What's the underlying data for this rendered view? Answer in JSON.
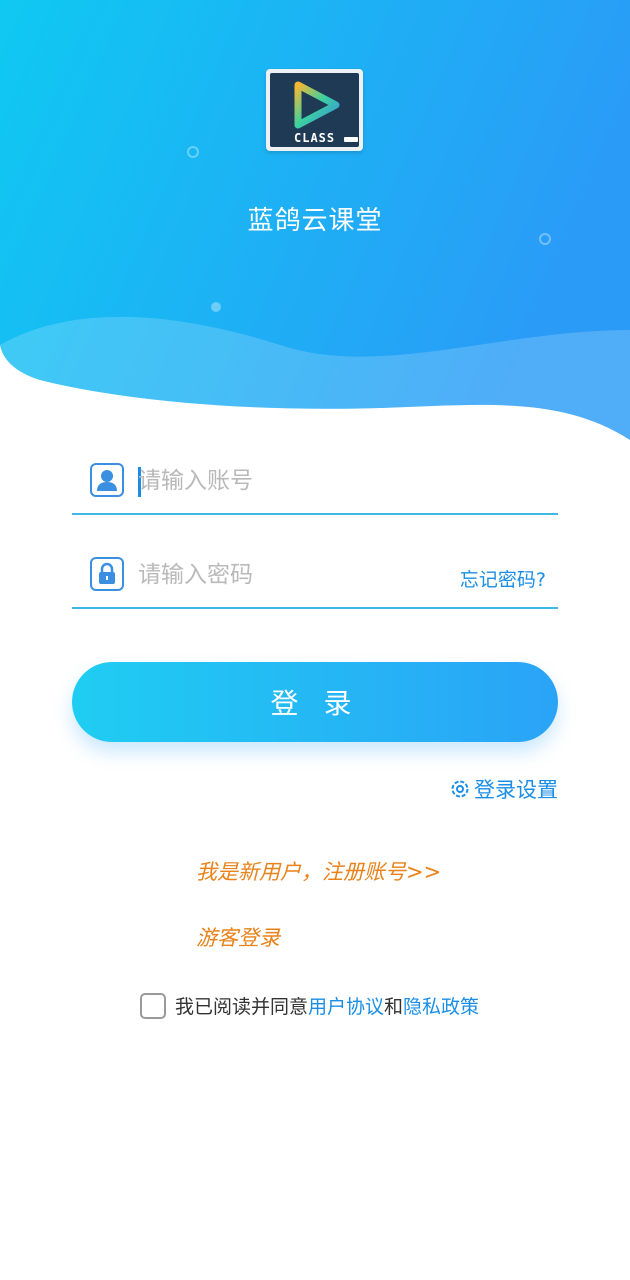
{
  "app": {
    "name": "蓝鸽云课堂",
    "logo_text": "CLASS"
  },
  "login_form": {
    "account_placeholder": "请输入账号",
    "password_placeholder": "请输入密码",
    "forgot_password": "忘记密码?",
    "submit_label": "登 录"
  },
  "settings": {
    "label": "登录设置",
    "icon": "gear-icon"
  },
  "links": {
    "register": "我是新用户，注册账号>>",
    "guest": "游客登录"
  },
  "agreement": {
    "checked": false,
    "prefix": "我已阅读并同意",
    "user_agreement": "用户协议",
    "joiner": "和",
    "privacy_policy": "隐私政策"
  },
  "colors": {
    "header_gradient_start": "#0fc9f2",
    "header_gradient_end": "#2a9bf7",
    "accent": "#1a8ee6",
    "link_orange": "#e8821a"
  }
}
